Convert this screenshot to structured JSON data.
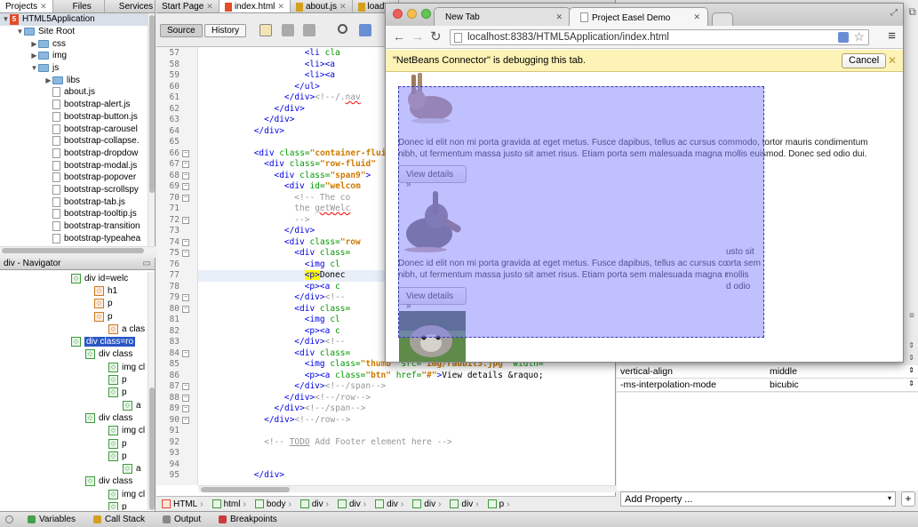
{
  "projects_panel": {
    "tabs": [
      "Projects",
      "Files",
      "Services"
    ],
    "tree": [
      {
        "label": "HTML5Application",
        "type": "project",
        "depth": 0,
        "expanded": true
      },
      {
        "label": "Site Root",
        "type": "folder",
        "depth": 1,
        "expanded": true
      },
      {
        "label": "css",
        "type": "folder",
        "depth": 2,
        "expanded": false
      },
      {
        "label": "img",
        "type": "folder",
        "depth": 2,
        "expanded": false
      },
      {
        "label": "js",
        "type": "folder",
        "depth": 2,
        "expanded": true
      },
      {
        "label": "libs",
        "type": "folder",
        "depth": 3,
        "expanded": false
      },
      {
        "label": "about.js",
        "type": "file",
        "depth": 3
      },
      {
        "label": "bootstrap-alert.js",
        "type": "file",
        "depth": 3
      },
      {
        "label": "bootstrap-button.js",
        "type": "file",
        "depth": 3
      },
      {
        "label": "bootstrap-carousel",
        "type": "file",
        "depth": 3
      },
      {
        "label": "bootstrap-collapse.",
        "type": "file",
        "depth": 3
      },
      {
        "label": "bootstrap-dropdow",
        "type": "file",
        "depth": 3
      },
      {
        "label": "bootstrap-modal.js",
        "type": "file",
        "depth": 3
      },
      {
        "label": "bootstrap-popover",
        "type": "file",
        "depth": 3
      },
      {
        "label": "bootstrap-scrollspy",
        "type": "file",
        "depth": 3
      },
      {
        "label": "bootstrap-tab.js",
        "type": "file",
        "depth": 3
      },
      {
        "label": "bootstrap-tooltip.js",
        "type": "file",
        "depth": 3
      },
      {
        "label": "bootstrap-transition",
        "type": "file",
        "depth": 3
      },
      {
        "label": "bootstrap-typeahea",
        "type": "file",
        "depth": 3
      }
    ]
  },
  "navigator": {
    "title": "div - Navigator",
    "items": [
      {
        "label": "div id=welc",
        "indent": 80,
        "icon": "g",
        "sel": false
      },
      {
        "label": "h1",
        "indent": 106,
        "icon": "o",
        "sel": false
      },
      {
        "label": "p",
        "indent": 106,
        "icon": "o",
        "sel": false
      },
      {
        "label": "p",
        "indent": 106,
        "icon": "o",
        "sel": false
      },
      {
        "label": "a clas",
        "indent": 122,
        "icon": "o",
        "sel": false
      },
      {
        "label": "div class=ro",
        "indent": 80,
        "icon": "g",
        "sel": true
      },
      {
        "label": "div class",
        "indent": 96,
        "icon": "g",
        "sel": false
      },
      {
        "label": "img cl",
        "indent": 122,
        "icon": "g",
        "sel": false
      },
      {
        "label": "p",
        "indent": 122,
        "icon": "g",
        "sel": false
      },
      {
        "label": "p",
        "indent": 122,
        "icon": "g",
        "sel": false
      },
      {
        "label": "a",
        "indent": 138,
        "icon": "g",
        "sel": false
      },
      {
        "label": "div class",
        "indent": 96,
        "icon": "g",
        "sel": false
      },
      {
        "label": "img cl",
        "indent": 122,
        "icon": "g",
        "sel": false
      },
      {
        "label": "p",
        "indent": 122,
        "icon": "g",
        "sel": false
      },
      {
        "label": "p",
        "indent": 122,
        "icon": "g",
        "sel": false
      },
      {
        "label": "a",
        "indent": 138,
        "icon": "g",
        "sel": false
      },
      {
        "label": "div class",
        "indent": 96,
        "icon": "g",
        "sel": false
      },
      {
        "label": "img cl",
        "indent": 122,
        "icon": "g",
        "sel": false
      },
      {
        "label": "p",
        "indent": 122,
        "icon": "g",
        "sel": false
      }
    ]
  },
  "editor": {
    "tabs": [
      "Start Page",
      "index.html",
      "about.js",
      "loadW"
    ],
    "source_label": "Source",
    "history_label": "History",
    "lines": [
      {
        "n": 57,
        "indent": 21,
        "html": "<span class='tag'>&lt;li</span> <span class='attr'>cla</span>"
      },
      {
        "n": 58,
        "indent": 21,
        "html": "<span class='tag'>&lt;li&gt;&lt;a</span>"
      },
      {
        "n": 59,
        "indent": 21,
        "html": "<span class='tag'>&lt;li&gt;&lt;a</span>"
      },
      {
        "n": 60,
        "indent": 19,
        "html": "<span class='tag'>&lt;/ul&gt;</span>"
      },
      {
        "n": 61,
        "indent": 17,
        "html": "<span class='tag'>&lt;/div&gt;</span><span class='cm'>&lt;!--/.</span><span class='cm' style='text-decoration:underline wavy red'>nav</span>"
      },
      {
        "n": 62,
        "indent": 15,
        "html": "<span class='tag'>&lt;/div&gt;</span>"
      },
      {
        "n": 63,
        "indent": 13,
        "html": "<span class='tag'>&lt;/div&gt;</span>"
      },
      {
        "n": 64,
        "indent": 11,
        "html": "<span class='tag'>&lt;/div&gt;</span>"
      },
      {
        "n": 65,
        "indent": 0,
        "html": ""
      },
      {
        "n": 66,
        "indent": 11,
        "html": "<span class='tag'>&lt;div</span> <span class='attr'>class=</span><span class='str'>\"container-fluid</span>"
      },
      {
        "n": 67,
        "indent": 13,
        "html": "<span class='tag'>&lt;div</span> <span class='attr'>class=</span><span class='str'>\"row-fluid\"</span>"
      },
      {
        "n": 68,
        "indent": 15,
        "html": "<span class='tag'>&lt;div</span> <span class='attr'>class=</span><span class='str'>\"span9\"</span><span class='tag'>&gt;</span>"
      },
      {
        "n": 69,
        "indent": 17,
        "html": "<span class='tag'>&lt;div</span> <span class='attr'>id=</span><span class='str'>\"welcom</span>"
      },
      {
        "n": 70,
        "indent": 19,
        "html": "<span class='cm'>&lt;!-- The co</span>"
      },
      {
        "n": 71,
        "indent": 19,
        "html": "<span class='cm'>the </span><span class='cm' style='text-decoration:underline wavy red'>getWelc</span>"
      },
      {
        "n": 72,
        "indent": 19,
        "html": "<span class='cm'>--&gt;</span>"
      },
      {
        "n": 73,
        "indent": 17,
        "html": "<span class='tag'>&lt;/div&gt;</span>"
      },
      {
        "n": 74,
        "indent": 17,
        "html": "<span class='tag'>&lt;div</span> <span class='attr'>class=</span><span class='str'>\"row</span>"
      },
      {
        "n": 75,
        "indent": 19,
        "html": "<span class='tag'>&lt;div</span> <span class='attr'>class=</span>"
      },
      {
        "n": 76,
        "indent": 21,
        "html": "<span class='tag'>&lt;img</span> <span class='attr'>cl</span>"
      },
      {
        "n": 77,
        "indent": 21,
        "html": "<span class='ptag'><span class='tag'>&lt;p&gt;</span></span>Donec",
        "hl": true
      },
      {
        "n": 78,
        "indent": 21,
        "html": "<span class='tag'>&lt;p&gt;&lt;a</span> <span class='attr'>c</span>"
      },
      {
        "n": 79,
        "indent": 19,
        "html": "<span class='tag'>&lt;/div&gt;</span><span class='cm'>&lt;!--</span>"
      },
      {
        "n": 80,
        "indent": 19,
        "html": "<span class='tag'>&lt;div</span> <span class='attr'>class=</span>"
      },
      {
        "n": 81,
        "indent": 21,
        "html": "<span class='tag'>&lt;img</span> <span class='attr'>cl</span>"
      },
      {
        "n": 82,
        "indent": 21,
        "html": "<span class='tag'>&lt;p&gt;&lt;a</span> <span class='attr'>c</span>"
      },
      {
        "n": 83,
        "indent": 19,
        "html": "<span class='tag'>&lt;/div&gt;</span><span class='cm'>&lt;!--</span>"
      },
      {
        "n": 84,
        "indent": 19,
        "html": "<span class='tag'>&lt;div</span> <span class='attr'>class=</span>"
      },
      {
        "n": 85,
        "indent": 21,
        "html": "<span class='tag'>&lt;img</span> <span class='attr'>class=</span><span class='str'>\"thumb\"</span> <span class='attr'>src=</span><span class='str'>\"img/rabbit3.jpg\"</span> <span class='attr'>width=</span>"
      },
      {
        "n": 86,
        "indent": 21,
        "html": "<span class='tag'>&lt;p&gt;&lt;a</span> <span class='attr'>class=</span><span class='str'>\"btn\"</span> <span class='attr'>href=</span><span class='str'>\"#\"</span><span class='tag'>&gt;</span>View details &amp;raquo;"
      },
      {
        "n": 87,
        "indent": 19,
        "html": "<span class='tag'>&lt;/div&gt;</span><span class='cm'>&lt;!--/span--&gt;</span>"
      },
      {
        "n": 88,
        "indent": 17,
        "html": "<span class='tag'>&lt;/div&gt;</span><span class='cm'>&lt;!--/row--&gt;</span>"
      },
      {
        "n": 89,
        "indent": 15,
        "html": "<span class='tag'>&lt;/div&gt;</span><span class='cm'>&lt;!--/span--&gt;</span>"
      },
      {
        "n": 90,
        "indent": 13,
        "html": "<span class='tag'>&lt;/div&gt;</span><span class='cm'>&lt;!--/row--&gt;</span>"
      },
      {
        "n": 91,
        "indent": 0,
        "html": ""
      },
      {
        "n": 92,
        "indent": 13,
        "html": "<span class='cm'>&lt;!-- </span><span class='cm' style='text-decoration:underline'>TODO</span><span class='cm'> Add Footer element here --&gt;</span>"
      },
      {
        "n": 93,
        "indent": 0,
        "html": ""
      },
      {
        "n": 94,
        "indent": 0,
        "html": ""
      },
      {
        "n": 95,
        "indent": 11,
        "html": "<span class='tag'>&lt;/div&gt;</span>"
      }
    ],
    "breadcrumbs": [
      "HTML",
      "html",
      "body",
      "div",
      "div",
      "div",
      "div",
      "div",
      "p"
    ]
  },
  "css_panel": {
    "properties": [
      {
        "name": "vertical-align",
        "value": "middle"
      },
      {
        "name": "-ms-interpolation-mode",
        "value": "bicubic"
      }
    ],
    "add_property_label": "Add Property ...",
    "add_button_label": "+"
  },
  "bottom_bar": {
    "items": [
      {
        "label": "Variables",
        "color": "#46a046"
      },
      {
        "label": "Call Stack",
        "color": "#d4a020"
      },
      {
        "label": "Output",
        "color": "#888888"
      },
      {
        "label": "Breakpoints",
        "color": "#c83c3c"
      }
    ]
  },
  "browser": {
    "tabs": [
      "New Tab",
      "Project Easel Demo"
    ],
    "url": "localhost:8383/HTML5Application/index.html",
    "info_message": "\"NetBeans Connector\" is debugging this tab.",
    "cancel_label": "Cancel",
    "paragraph_text": "Donec id elit non mi porta gravida at eget metus. Fusce dapibus, tellus ac cursus commodo, tortor mauris condimentum nibh, ut fermentum massa justo sit amet risus. Etiam porta sem malesuada magna mollis euismod. Donec sed odio dui.",
    "para2_lines": [
      "Donec id elit non mi porta gravida at eget metus. Fusce dapibus, tellus ac cursus co",
      "nibh, ut fermentum massa justo sit amet risus. Etiam porta sem malesuada magna r"
    ],
    "para2_right_lines": [
      "usto sit",
      "orta sem",
      "mollis",
      "d odio"
    ],
    "button_label": "View details »"
  },
  "colors": {
    "selection_overlay": "#8282ff",
    "html5_icon": "#e34c26",
    "info_bar": "#fdf3b6"
  }
}
